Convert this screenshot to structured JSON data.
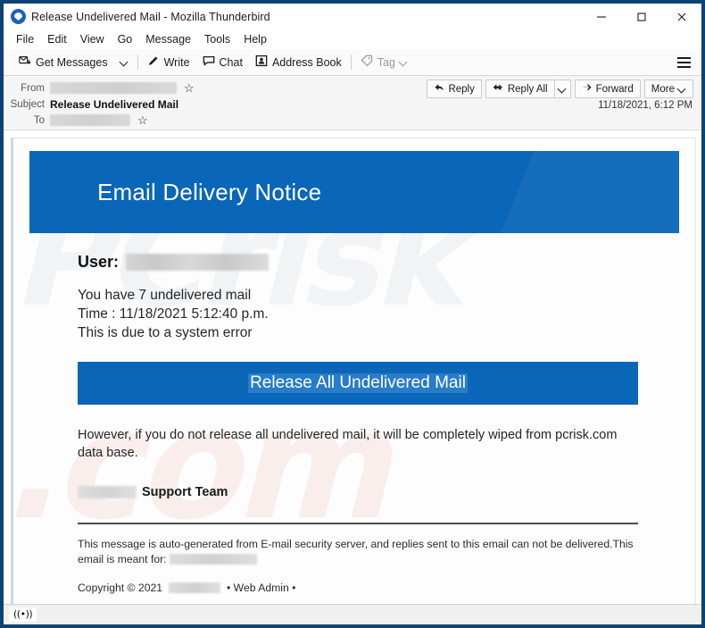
{
  "window": {
    "title": "Release Undelivered Mail - Mozilla Thunderbird",
    "logo_icon": "thunderbird-logo-icon",
    "controls": {
      "minimize": "minimize-icon",
      "maximize": "maximize-icon",
      "close": "close-icon"
    }
  },
  "menubar": {
    "items": [
      {
        "label": "File"
      },
      {
        "label": "Edit"
      },
      {
        "label": "View"
      },
      {
        "label": "Go"
      },
      {
        "label": "Message"
      },
      {
        "label": "Tools"
      },
      {
        "label": "Help"
      }
    ]
  },
  "toolbar": {
    "get_messages": "Get Messages",
    "get_messages_icon": "download-mail-icon",
    "get_messages_caret": "chevron-down-icon",
    "write": "Write",
    "write_icon": "pencil-icon",
    "chat": "Chat",
    "chat_icon": "speech-bubble-icon",
    "address_book": "Address Book",
    "address_book_icon": "contact-card-icon",
    "tag": "Tag",
    "tag_icon": "tag-icon",
    "tag_caret": "chevron-down-icon",
    "menu_icon": "hamburger-menu-icon"
  },
  "message_header": {
    "from_label": "From",
    "from_value": "",
    "from_star_icon": "star-icon",
    "subject_label": "Subject",
    "subject_value": "Release Undelivered Mail",
    "to_label": "To",
    "to_value": "",
    "to_star_icon": "star-icon",
    "date": "11/18/2021, 6:12 PM",
    "actions": {
      "reply": "Reply",
      "reply_icon": "reply-arrow-icon",
      "reply_all": "Reply All",
      "reply_all_icon": "reply-all-arrow-icon",
      "reply_all_caret": "chevron-down-icon",
      "forward": "Forward",
      "forward_icon": "forward-arrow-icon",
      "more": "More",
      "more_caret": "chevron-down-icon"
    }
  },
  "email": {
    "banner_title": "Email Delivery Notice",
    "user_label": "User:",
    "user_value": "",
    "line_1": "You have 7 undelivered mail",
    "line_2": "Time : 11/18/2021 5:12:40 p.m.",
    "line_3": "This is due to a system error",
    "cta_label": "Release All Undelivered Mail",
    "warning": "However, if you do not release all undelivered mail, it will be completely wiped from pcrisk.com data base.",
    "signature_redacted": "",
    "signature": "Support Team",
    "fineprint_1": "This message is auto-generated from E-mail security server, and replies sent to this email can not be delivered.This email is meant for:",
    "fineprint_redacted": "",
    "copyright_prefix": "Copyright © 2021",
    "copyright_redacted": "",
    "copyright_suffix": "• Web Admin •",
    "watermark": "PCrisk",
    "watermark_2": ".com"
  },
  "statusbar": {
    "icon": "((•))",
    "icon_name": "connection-status-icon"
  },
  "colors": {
    "brand_blue": "#0a66b8",
    "window_border": "#0d4372",
    "toolbar_bg": "#fafafa",
    "header_bg": "#f5f5f5"
  }
}
